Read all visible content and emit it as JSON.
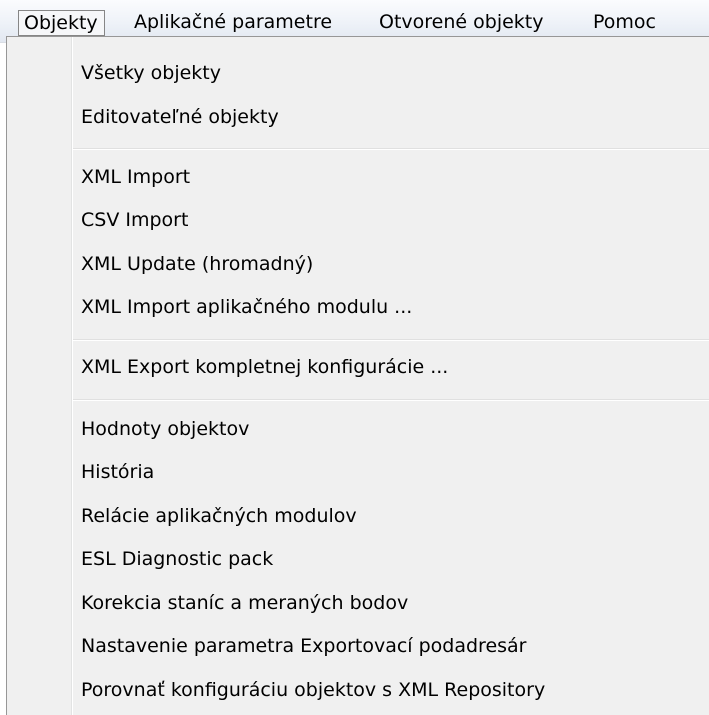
{
  "menubar": {
    "items": [
      {
        "label": "Objekty"
      },
      {
        "label": "Aplikačné parametre"
      },
      {
        "label": "Otvorené objekty"
      },
      {
        "label": "Pomoc"
      }
    ]
  },
  "dropdown": {
    "groups": [
      {
        "items": [
          "Všetky objekty",
          "Editovateľné objekty"
        ]
      },
      {
        "items": [
          "XML Import",
          "CSV Import",
          "XML Update (hromadný)",
          "XML Import aplikačného modulu ..."
        ]
      },
      {
        "items": [
          "XML Export kompletnej konfigurácie ..."
        ]
      },
      {
        "items": [
          "Hodnoty objektov",
          "História",
          "Relácie aplikačných modulov",
          "ESL Diagnostic pack",
          "Korekcia staníc a meraných bodov",
          "Nastavenie parametra Exportovací podadresár",
          "Porovnať konfiguráciu objektov s XML Repository"
        ]
      }
    ]
  }
}
